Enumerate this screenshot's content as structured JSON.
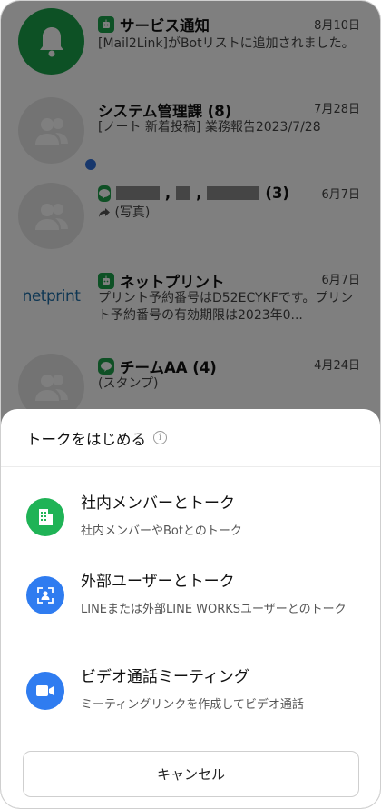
{
  "chats": [
    {
      "title": "サービス通知",
      "date": "8月10日",
      "message": "[Mail2Link]がBotリストに追加されました。",
      "tag": "bot",
      "avatar": "bell-icon"
    },
    {
      "title": "システム管理課 (8)",
      "date": "7月28日",
      "message": "[ノート 新着投稿] 業務報告2023/7/28",
      "tag": "none",
      "avatar": "group-icon"
    },
    {
      "title_suffix": "(3)",
      "title_separators": [
        ",",
        ","
      ],
      "date": "6月7日",
      "message": "(写真)",
      "tag": "line",
      "avatar": "group-icon"
    },
    {
      "title": "ネットプリント",
      "date": "6月7日",
      "message": "プリント予約番号はD52ECYKFです。プリント予約番号の有効期限は2023年0...",
      "tag": "bot",
      "avatar_text": "netprint"
    },
    {
      "title": "チームAA (4)",
      "date": "4月24日",
      "message": "(スタンプ)",
      "tag": "line",
      "avatar": "group-icon"
    }
  ],
  "sheet": {
    "title": "トークをはじめる",
    "options": [
      {
        "title": "社内メンバーとトーク",
        "desc": "社内メンバーやBotとのトーク",
        "icon": "building-icon",
        "color": "#1fb356"
      },
      {
        "title": "外部ユーザーとトーク",
        "desc": "LINEまたは外部LINE WORKSユーザーとのトーク",
        "icon": "external-user-icon",
        "color": "#2f7cf0"
      },
      {
        "title": "ビデオ通話ミーティング",
        "desc": "ミーティングリンクを作成してビデオ通話",
        "icon": "video-camera-icon",
        "color": "#2f7cf0"
      }
    ],
    "cancel": "キャンセル"
  }
}
